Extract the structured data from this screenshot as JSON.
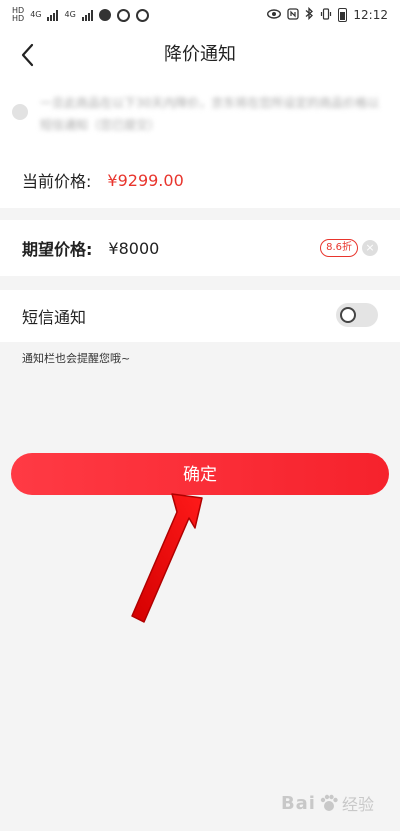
{
  "status_bar": {
    "network_1": "4G",
    "network_2": "4G",
    "time": "12:12"
  },
  "nav": {
    "title": "降价通知"
  },
  "notice": {
    "text": "一旦此商品在以下30天内降价，京东将在您所设定的商品价格以短信通知（您已提交）"
  },
  "current_price": {
    "label": "当前价格:",
    "value": "¥9299.00"
  },
  "expected_price": {
    "label": "期望价格:",
    "value": "¥8000",
    "discount_badge": "8.6折"
  },
  "sms": {
    "label": "短信通知",
    "enabled": false
  },
  "hint": "通知栏也会提醒您哦~",
  "confirm_button": "确定",
  "watermark": {
    "brand": "Bai",
    "brand_suffix": "经验"
  },
  "colors": {
    "accent": "#e8352d",
    "button": "#f6222c",
    "annotation_arrow": "#ff0000"
  }
}
